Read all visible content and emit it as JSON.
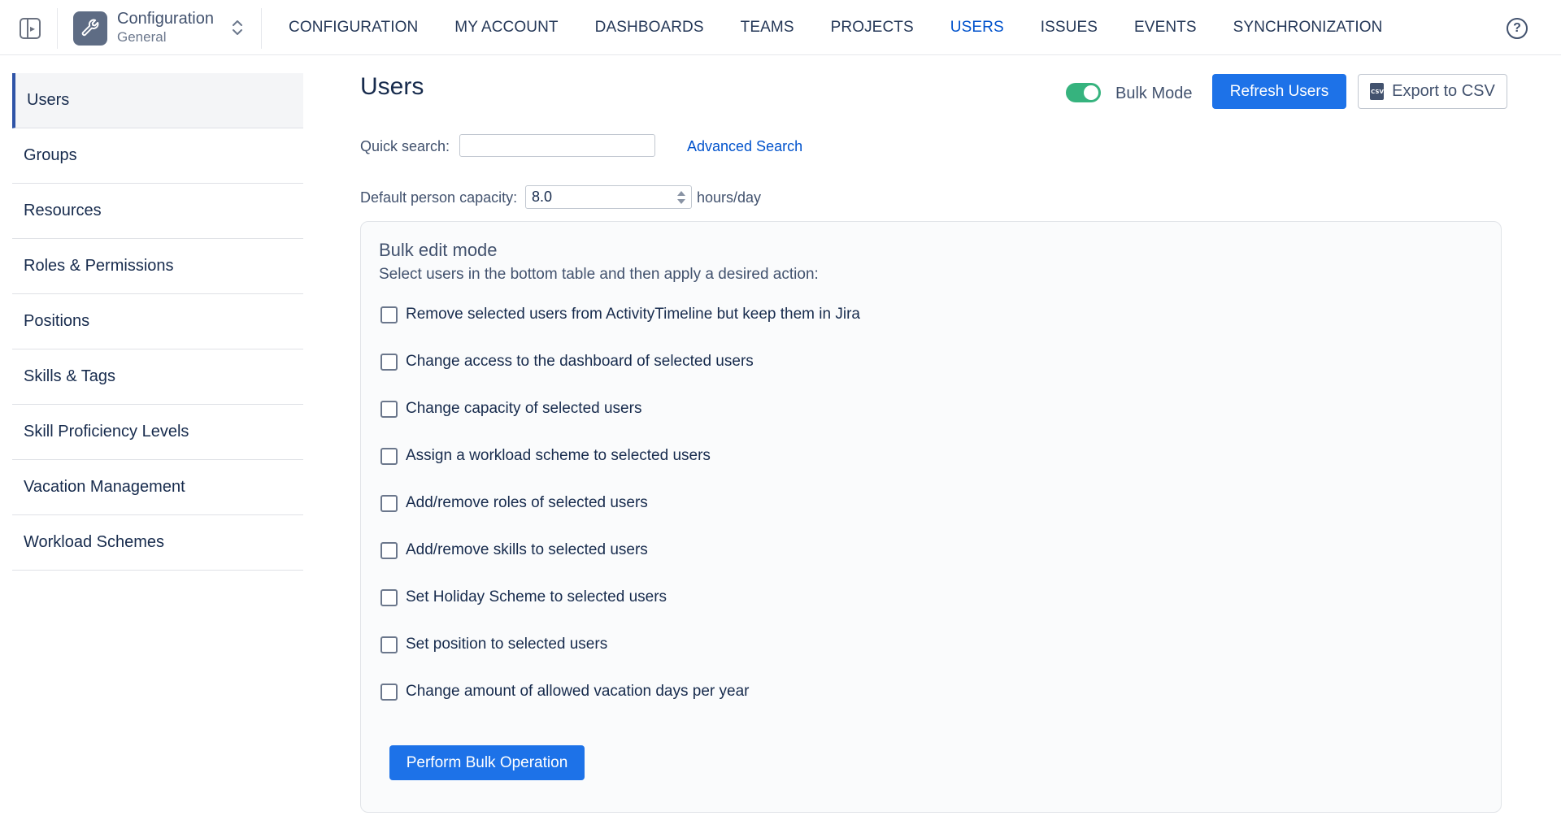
{
  "header": {
    "app_title": "Configuration",
    "app_subtitle": "General",
    "nav": [
      {
        "label": "CONFIGURATION"
      },
      {
        "label": "MY ACCOUNT"
      },
      {
        "label": "DASHBOARDS"
      },
      {
        "label": "TEAMS"
      },
      {
        "label": "PROJECTS"
      },
      {
        "label": "USERS",
        "active": true
      },
      {
        "label": "ISSUES"
      },
      {
        "label": "EVENTS"
      },
      {
        "label": "SYNCHRONIZATION"
      }
    ],
    "help_icon": "?"
  },
  "sidebar": {
    "items": [
      {
        "label": "Users",
        "active": true
      },
      {
        "label": "Groups"
      },
      {
        "label": "Resources"
      },
      {
        "label": "Roles & Permissions"
      },
      {
        "label": "Positions"
      },
      {
        "label": "Skills & Tags"
      },
      {
        "label": "Skill Proficiency Levels"
      },
      {
        "label": "Vacation Management"
      },
      {
        "label": "Workload Schemes"
      }
    ]
  },
  "main": {
    "title": "Users",
    "bulk_mode_label": "Bulk Mode",
    "bulk_mode_on": true,
    "refresh_label": "Refresh Users",
    "export_label": "Export to CSV",
    "csv_icon_text": "CSV",
    "quick_search_label": "Quick search:",
    "quick_search_value": "",
    "advanced_search_label": "Advanced Search",
    "capacity_label": "Default person capacity:",
    "capacity_value": "8.0",
    "capacity_unit": "hours/day"
  },
  "bulk": {
    "title": "Bulk edit mode",
    "description": "Select users in the bottom table and then apply a desired action:",
    "options": [
      {
        "label": "Remove selected users from ActivityTimeline but keep them in Jira",
        "checked": false
      },
      {
        "label": "Change access to the dashboard of selected users",
        "checked": false
      },
      {
        "label": "Change capacity of selected users",
        "checked": false
      },
      {
        "label": "Assign a workload scheme to selected users",
        "checked": false
      },
      {
        "label": "Add/remove roles of selected users",
        "checked": false
      },
      {
        "label": "Add/remove skills to selected users",
        "checked": false
      },
      {
        "label": "Set Holiday Scheme to selected users",
        "checked": false
      },
      {
        "label": "Set position to selected users",
        "checked": false
      },
      {
        "label": "Change amount of allowed vacation days per year",
        "checked": false
      }
    ],
    "perform_label": "Perform Bulk Operation"
  },
  "colors": {
    "primary": "#1d72e8",
    "active_nav": "#0052cc",
    "toggle_on": "#36b37e",
    "sidebar_active_bar": "#2f54a7"
  }
}
